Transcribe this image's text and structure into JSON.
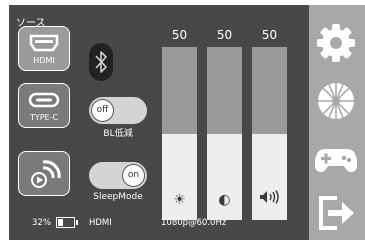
{
  "source": {
    "label": "ソース",
    "buttons": [
      {
        "label": "HDMI",
        "icon": "hdmi-port-icon",
        "active": true
      },
      {
        "label": "TYPE-C",
        "icon": "usb-c-port-icon",
        "active": false
      },
      {
        "label": "",
        "icon": "screen-cast-icon",
        "active": false
      }
    ]
  },
  "bluetooth": {
    "icon": "bluetooth-icon"
  },
  "toggles": {
    "bl_reduction": {
      "label": "BL低減",
      "state": "off"
    },
    "sleep_mode": {
      "label": "SleepMode",
      "state": "on"
    }
  },
  "sliders": [
    {
      "name": "brightness",
      "value_text": "50",
      "value": 50,
      "icon": "sun-icon"
    },
    {
      "name": "contrast",
      "value_text": "50",
      "value": 50,
      "icon": "contrast-icon"
    },
    {
      "name": "volume",
      "value_text": "50",
      "value": 50,
      "icon": "speaker-icon"
    }
  ],
  "status": {
    "battery": "32%",
    "battery_level": 0.32,
    "input": "HDMI",
    "resolution": "1080p@60.0Hz"
  },
  "rail": [
    {
      "name": "settings",
      "icon": "gear-icon"
    },
    {
      "name": "display",
      "icon": "aperture-icon"
    },
    {
      "name": "game",
      "icon": "gamepad-icon"
    },
    {
      "name": "exit",
      "icon": "exit-icon"
    }
  ],
  "colors": {
    "panel": "#484848",
    "rail": "#a8a8a8",
    "slider_fill": "#eeeeee",
    "slider_track": "#9a9a9a"
  }
}
